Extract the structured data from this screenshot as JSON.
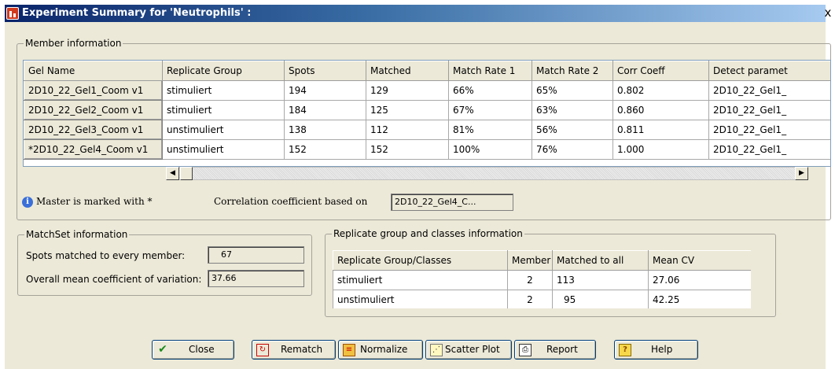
{
  "window": {
    "title": "Experiment Summary for 'Neutrophils' :",
    "close_glyph": "x"
  },
  "member_info": {
    "title": "Member information",
    "columns": [
      "Gel Name",
      "Replicate Group",
      "Spots",
      "Matched",
      "Match Rate 1",
      "Match Rate 2",
      "Corr Coeff",
      "Detect paramet"
    ],
    "rows": [
      {
        "gel": "2D10_22_Gel1_Coom v1",
        "group": "stimuliert",
        "spots": "194",
        "matched": "129",
        "rate1": "66%",
        "rate2": "65%",
        "corr": "0.802",
        "detect": "2D10_22_Gel1_"
      },
      {
        "gel": "2D10_22_Gel2_Coom v1",
        "group": "stimuliert",
        "spots": "184",
        "matched": "125",
        "rate1": "67%",
        "rate2": "63%",
        "corr": "0.860",
        "detect": "2D10_22_Gel1_"
      },
      {
        "gel": "2D10_22_Gel3_Coom v1",
        "group": "unstimuliert",
        "spots": "138",
        "matched": "112",
        "rate1": "81%",
        "rate2": "56%",
        "corr": "0.811",
        "detect": "2D10_22_Gel1_"
      },
      {
        "gel": "*2D10_22_Gel4_Coom v1",
        "group": "unstimuliert",
        "spots": "152",
        "matched": "152",
        "rate1": "100%",
        "rate2": "76%",
        "corr": "1.000",
        "detect": "2D10_22_Gel1_"
      }
    ],
    "master_note": "Master is marked with *",
    "corr_label": "Correlation coefficient based on",
    "corr_value": "2D10_22_Gel4_C..."
  },
  "matchset": {
    "title": "MatchSet information",
    "spots_label": "Spots matched to every member:",
    "spots_value": "67",
    "cv_label": "Overall mean coefficient of variation:",
    "cv_value": "37.66"
  },
  "replicate": {
    "title": "Replicate group and classes information",
    "columns": [
      "Replicate Group/Classes",
      "Member",
      "Matched to all",
      "Mean CV"
    ],
    "rows": [
      {
        "name": "stimuliert",
        "member": "2",
        "matched": "113",
        "cv": "27.06"
      },
      {
        "name": "unstimuliert",
        "member": "2",
        "matched": "95",
        "cv": "42.25"
      }
    ]
  },
  "buttons": {
    "close": "Close",
    "rematch": "Rematch",
    "normalize": "Normalize",
    "scatter": "Scatter Plot",
    "report": "Report",
    "help": "Help"
  }
}
